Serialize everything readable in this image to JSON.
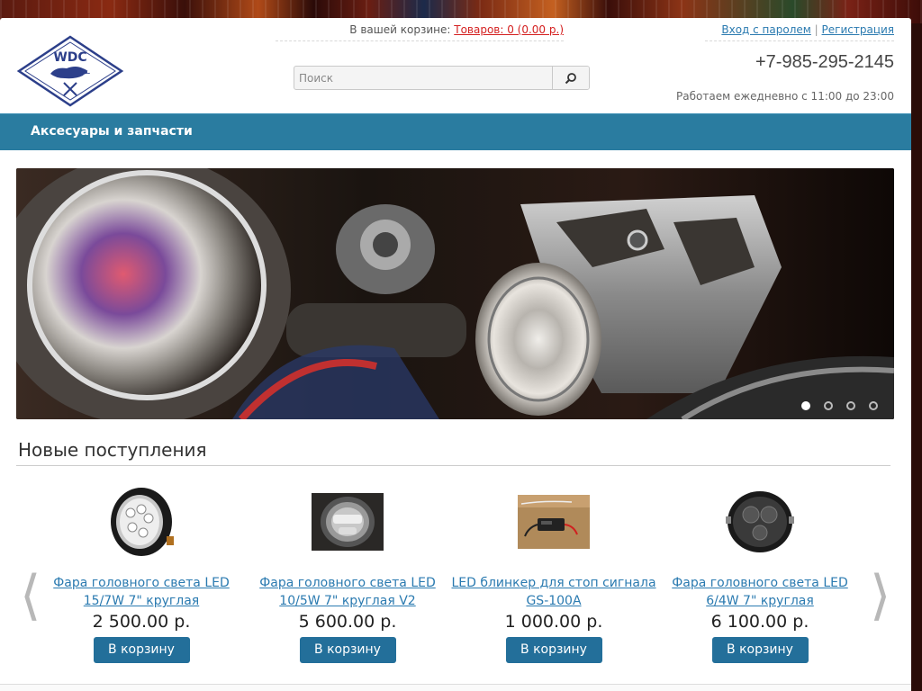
{
  "header": {
    "logo_text": "WDC",
    "cart_prefix": "В вашей корзине:",
    "cart_link": "Товаров: 0 (0.00 р.)",
    "login_link": "Вход с паролем",
    "auth_separator": "|",
    "register_link": "Регистрация",
    "search_placeholder": "Поиск",
    "phone": "+7-985-295-2145",
    "hours": "Работаем ежедневно с 11:00 до 23:00"
  },
  "nav": {
    "items": [
      {
        "label": "Аксесуары и запчасти"
      }
    ]
  },
  "banner": {
    "slides_count": 4,
    "active_slide": 1
  },
  "new_arrivals": {
    "title": "Новые поступления",
    "prev_arrow": "⟨",
    "next_arrow": "⟩",
    "products": [
      {
        "name": "Фара головного света LED 15/7W 7\" круглая",
        "price": "2 500.00 р.",
        "button": "В корзину"
      },
      {
        "name": "Фара головного света LED 10/5W 7\" круглая V2",
        "price": "5 600.00 р.",
        "button": "В корзину"
      },
      {
        "name": "LED блинкер для стоп сигнала GS-100A",
        "price": "1 000.00 р.",
        "button": "В корзину"
      },
      {
        "name": "Фара головного света LED 6/4W 7\" круглая",
        "price": "6 100.00 р.",
        "button": "В корзину"
      }
    ]
  },
  "colors": {
    "nav_bg": "#2a7ca0",
    "link": "#2a7ab0",
    "cart_link": "#d42020",
    "button_bg": "#236f9a"
  }
}
